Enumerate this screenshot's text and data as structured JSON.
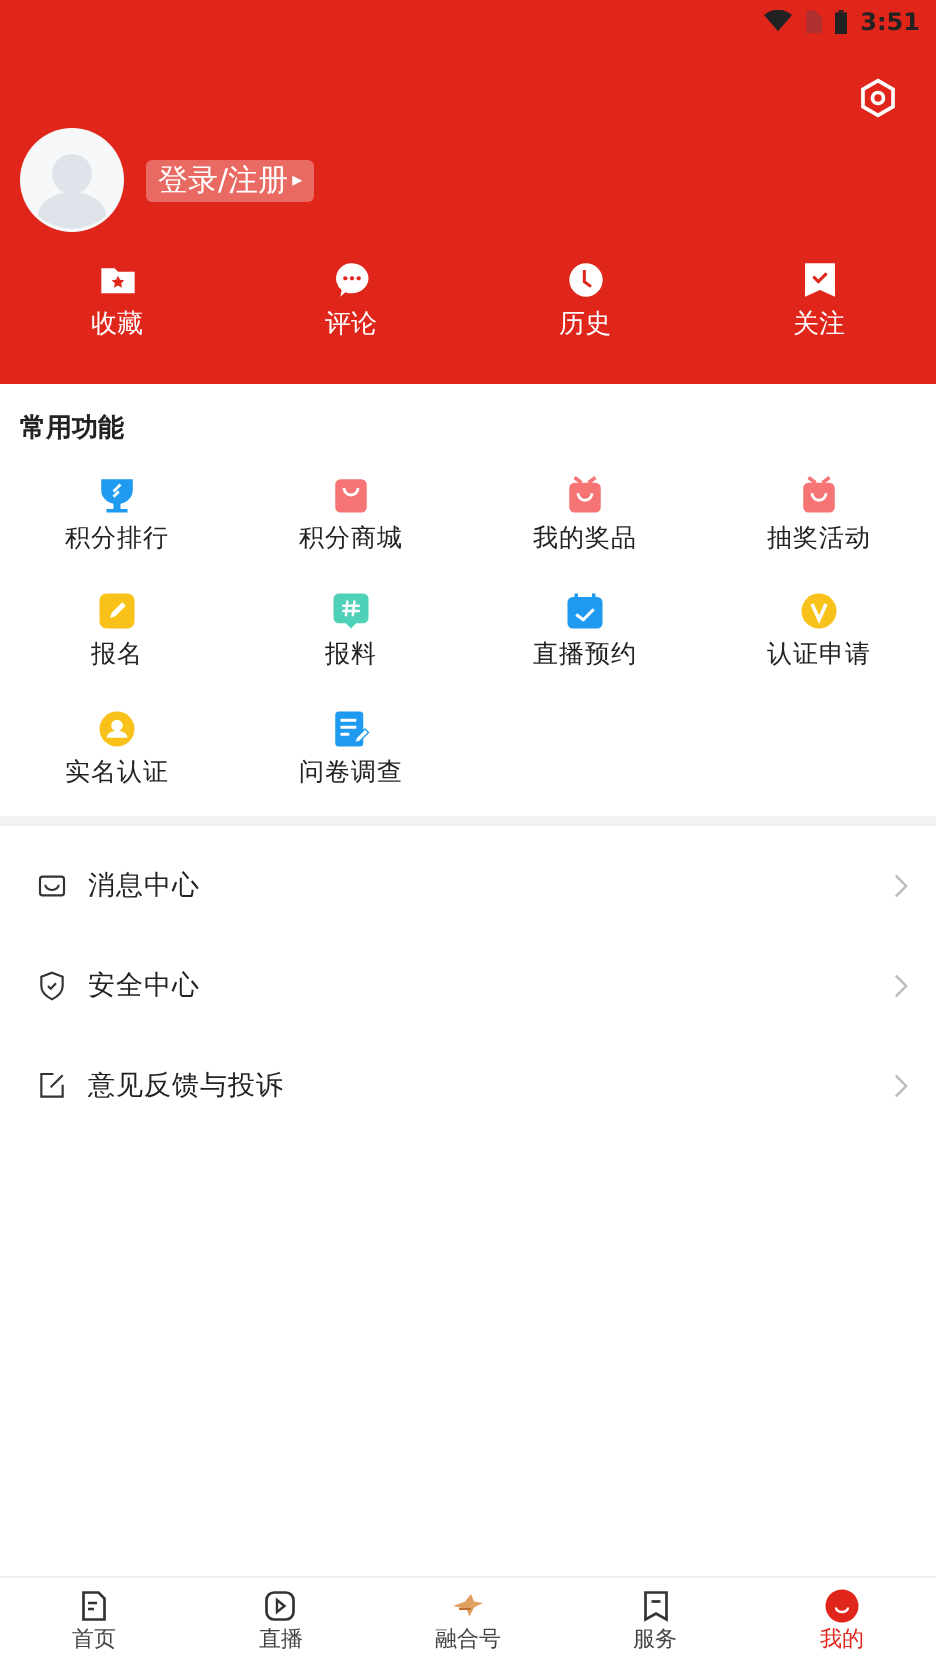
{
  "status_bar": {
    "time": "3:51"
  },
  "profile": {
    "login_label": "登录/注册",
    "caret": "▸"
  },
  "shortcuts": [
    {
      "label": "收藏"
    },
    {
      "label": "评论"
    },
    {
      "label": "历史"
    },
    {
      "label": "关注"
    }
  ],
  "functions": {
    "title": "常用功能",
    "items": [
      {
        "label": "积分排行"
      },
      {
        "label": "积分商城"
      },
      {
        "label": "我的奖品"
      },
      {
        "label": "抽奖活动"
      },
      {
        "label": "报名"
      },
      {
        "label": "报料"
      },
      {
        "label": "直播预约"
      },
      {
        "label": "认证申请"
      },
      {
        "label": "实名认证"
      },
      {
        "label": "问卷调查"
      }
    ]
  },
  "menu": [
    {
      "label": "消息中心"
    },
    {
      "label": "安全中心"
    },
    {
      "label": "意见反馈与投诉"
    }
  ],
  "tab_bar": [
    {
      "label": "首页",
      "selected": false
    },
    {
      "label": "直播",
      "selected": false
    },
    {
      "label": "融合号",
      "selected": false
    },
    {
      "label": "服务",
      "selected": false
    },
    {
      "label": "我的",
      "selected": true
    }
  ]
}
